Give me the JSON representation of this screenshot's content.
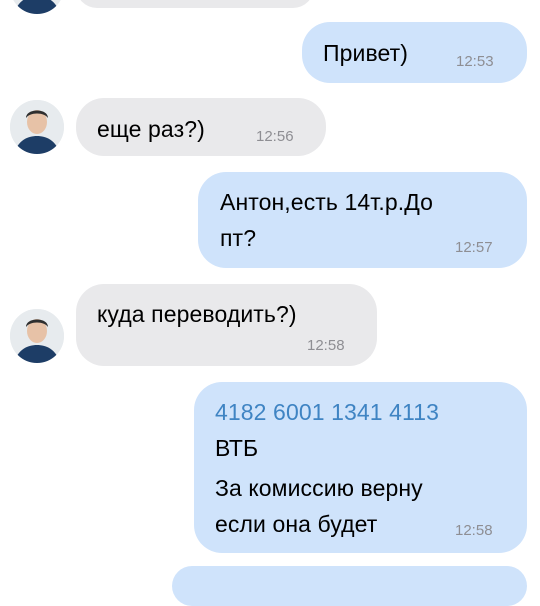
{
  "messages": [
    {
      "type": "outgoing",
      "text": "Привет)",
      "time": "12:53"
    },
    {
      "type": "incoming",
      "text": "еще раз?)",
      "time": "12:56"
    },
    {
      "type": "outgoing",
      "lines": [
        "Антон,есть 14т.р.До",
        "пт?"
      ],
      "time": "12:57"
    },
    {
      "type": "incoming",
      "text": "куда переводить?)",
      "time": "12:58"
    },
    {
      "type": "outgoing",
      "card_number": "4182 6001 1341 4113",
      "lines": [
        "ВТБ",
        "За комиссию верну",
        "если она будет"
      ],
      "time": "12:58"
    }
  ],
  "colors": {
    "incoming_bubble": "#e9e9eb",
    "outgoing_bubble": "#cfe3fb",
    "link": "#3f84c3",
    "timestamp": "#8e8e93"
  },
  "icons": {
    "avatar": "contact-avatar-photo"
  }
}
